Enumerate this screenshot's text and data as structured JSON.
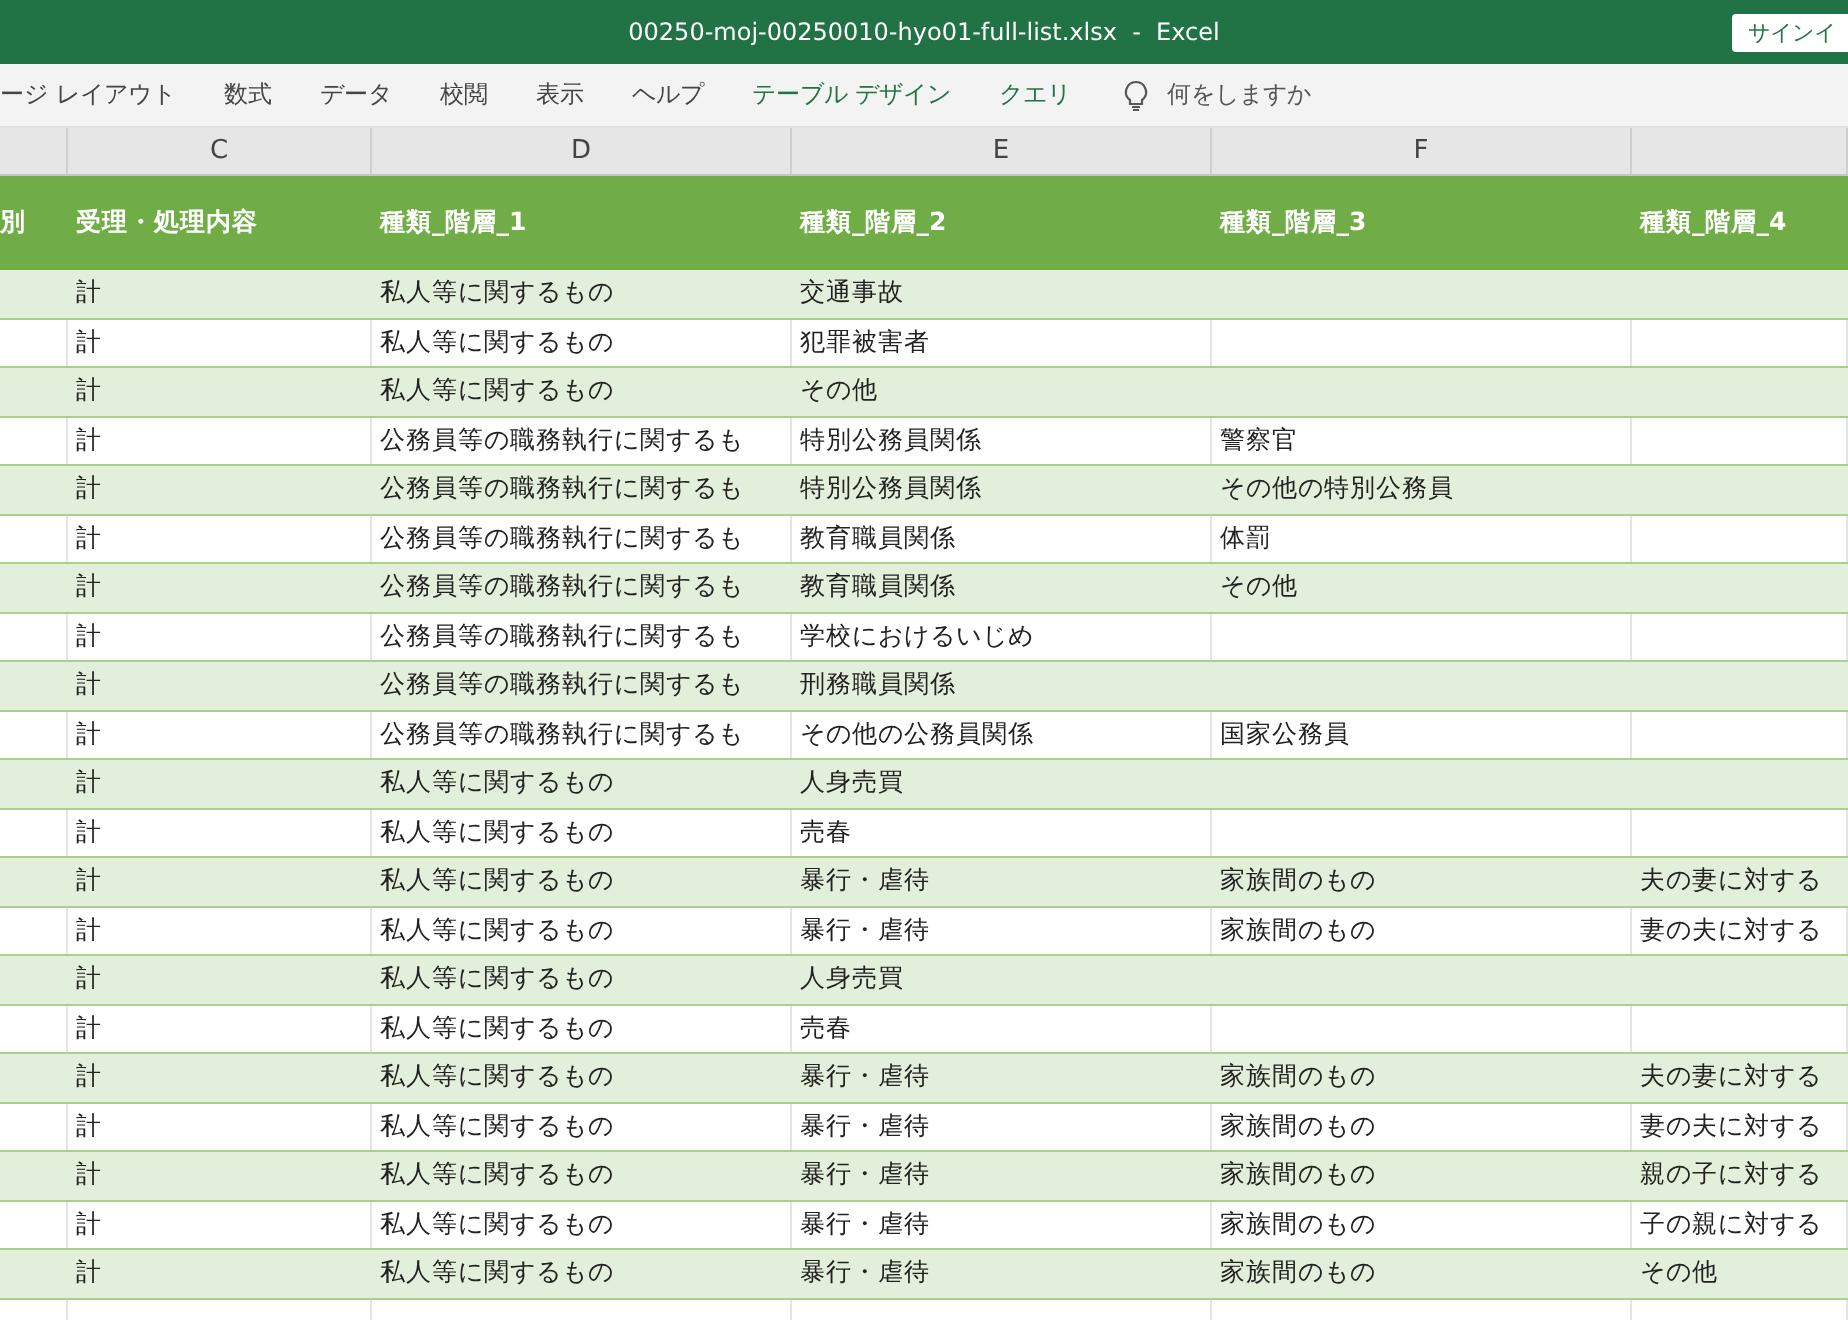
{
  "window": {
    "title": "00250-moj-00250010-hyo01-full-list.xlsx  -  Excel",
    "sign_in_button": "サインイ"
  },
  "ribbon": {
    "tabs": [
      {
        "label": "ージ レイアウト",
        "kind": "standard"
      },
      {
        "label": "数式",
        "kind": "standard"
      },
      {
        "label": "データ",
        "kind": "standard"
      },
      {
        "label": "校閲",
        "kind": "standard"
      },
      {
        "label": "表示",
        "kind": "standard"
      },
      {
        "label": "ヘルプ",
        "kind": "standard"
      },
      {
        "label": "テーブル デザイン",
        "kind": "contextual"
      },
      {
        "label": "クエリ",
        "kind": "contextual"
      }
    ],
    "tell_me": {
      "placeholder": "何をしますか"
    }
  },
  "column_letters": [
    "C",
    "D",
    "E",
    "F"
  ],
  "table": {
    "columns": [
      "別",
      "受理・処理内容",
      "種類_階層_1",
      "種類_階層_2",
      "種類_階層_3",
      "種類_階層_4"
    ],
    "rows": [
      {
        "c": "計",
        "d": "私人等に関するもの",
        "e": "交通事故"
      },
      {
        "c": "計",
        "d": "私人等に関するもの",
        "e": "犯罪被害者"
      },
      {
        "c": "計",
        "d": "私人等に関するもの",
        "e": "その他"
      },
      {
        "c": "計",
        "d": "公務員等の職務執行に関するも",
        "e": "特別公務員関係",
        "f": "警察官"
      },
      {
        "c": "計",
        "d": "公務員等の職務執行に関するも",
        "e": "特別公務員関係",
        "f": "その他の特別公務員"
      },
      {
        "c": "計",
        "d": "公務員等の職務執行に関するも",
        "e": "教育職員関係",
        "f": "体罰"
      },
      {
        "c": "計",
        "d": "公務員等の職務執行に関するも",
        "e": "教育職員関係",
        "f": "その他"
      },
      {
        "c": "計",
        "d": "公務員等の職務執行に関するも",
        "e": "学校におけるいじめ"
      },
      {
        "c": "計",
        "d": "公務員等の職務執行に関するも",
        "e": "刑務職員関係"
      },
      {
        "c": "計",
        "d": "公務員等の職務執行に関するも",
        "e": "その他の公務員関係",
        "f": "国家公務員"
      },
      {
        "c": "計",
        "d": "私人等に関するもの",
        "e": "人身売買"
      },
      {
        "c": "計",
        "d": "私人等に関するもの",
        "e": "売春"
      },
      {
        "c": "計",
        "d": "私人等に関するもの",
        "e": "暴行・虐待",
        "f": "家族間のもの",
        "g": "夫の妻に対する"
      },
      {
        "c": "計",
        "d": "私人等に関するもの",
        "e": "暴行・虐待",
        "f": "家族間のもの",
        "g": "妻の夫に対する"
      },
      {
        "c": "計",
        "d": "私人等に関するもの",
        "e": "人身売買"
      },
      {
        "c": "計",
        "d": "私人等に関するもの",
        "e": "売春"
      },
      {
        "c": "計",
        "d": "私人等に関するもの",
        "e": "暴行・虐待",
        "f": "家族間のもの",
        "g": "夫の妻に対する"
      },
      {
        "c": "計",
        "d": "私人等に関するもの",
        "e": "暴行・虐待",
        "f": "家族間のもの",
        "g": "妻の夫に対する"
      },
      {
        "c": "計",
        "d": "私人等に関するもの",
        "e": "暴行・虐待",
        "f": "家族間のもの",
        "g": "親の子に対する"
      },
      {
        "c": "計",
        "d": "私人等に関するもの",
        "e": "暴行・虐待",
        "f": "家族間のもの",
        "g": "子の親に対する"
      },
      {
        "c": "計",
        "d": "私人等に関するもの",
        "e": "暴行・虐待",
        "f": "家族間のもの",
        "g": "その他"
      }
    ]
  }
}
